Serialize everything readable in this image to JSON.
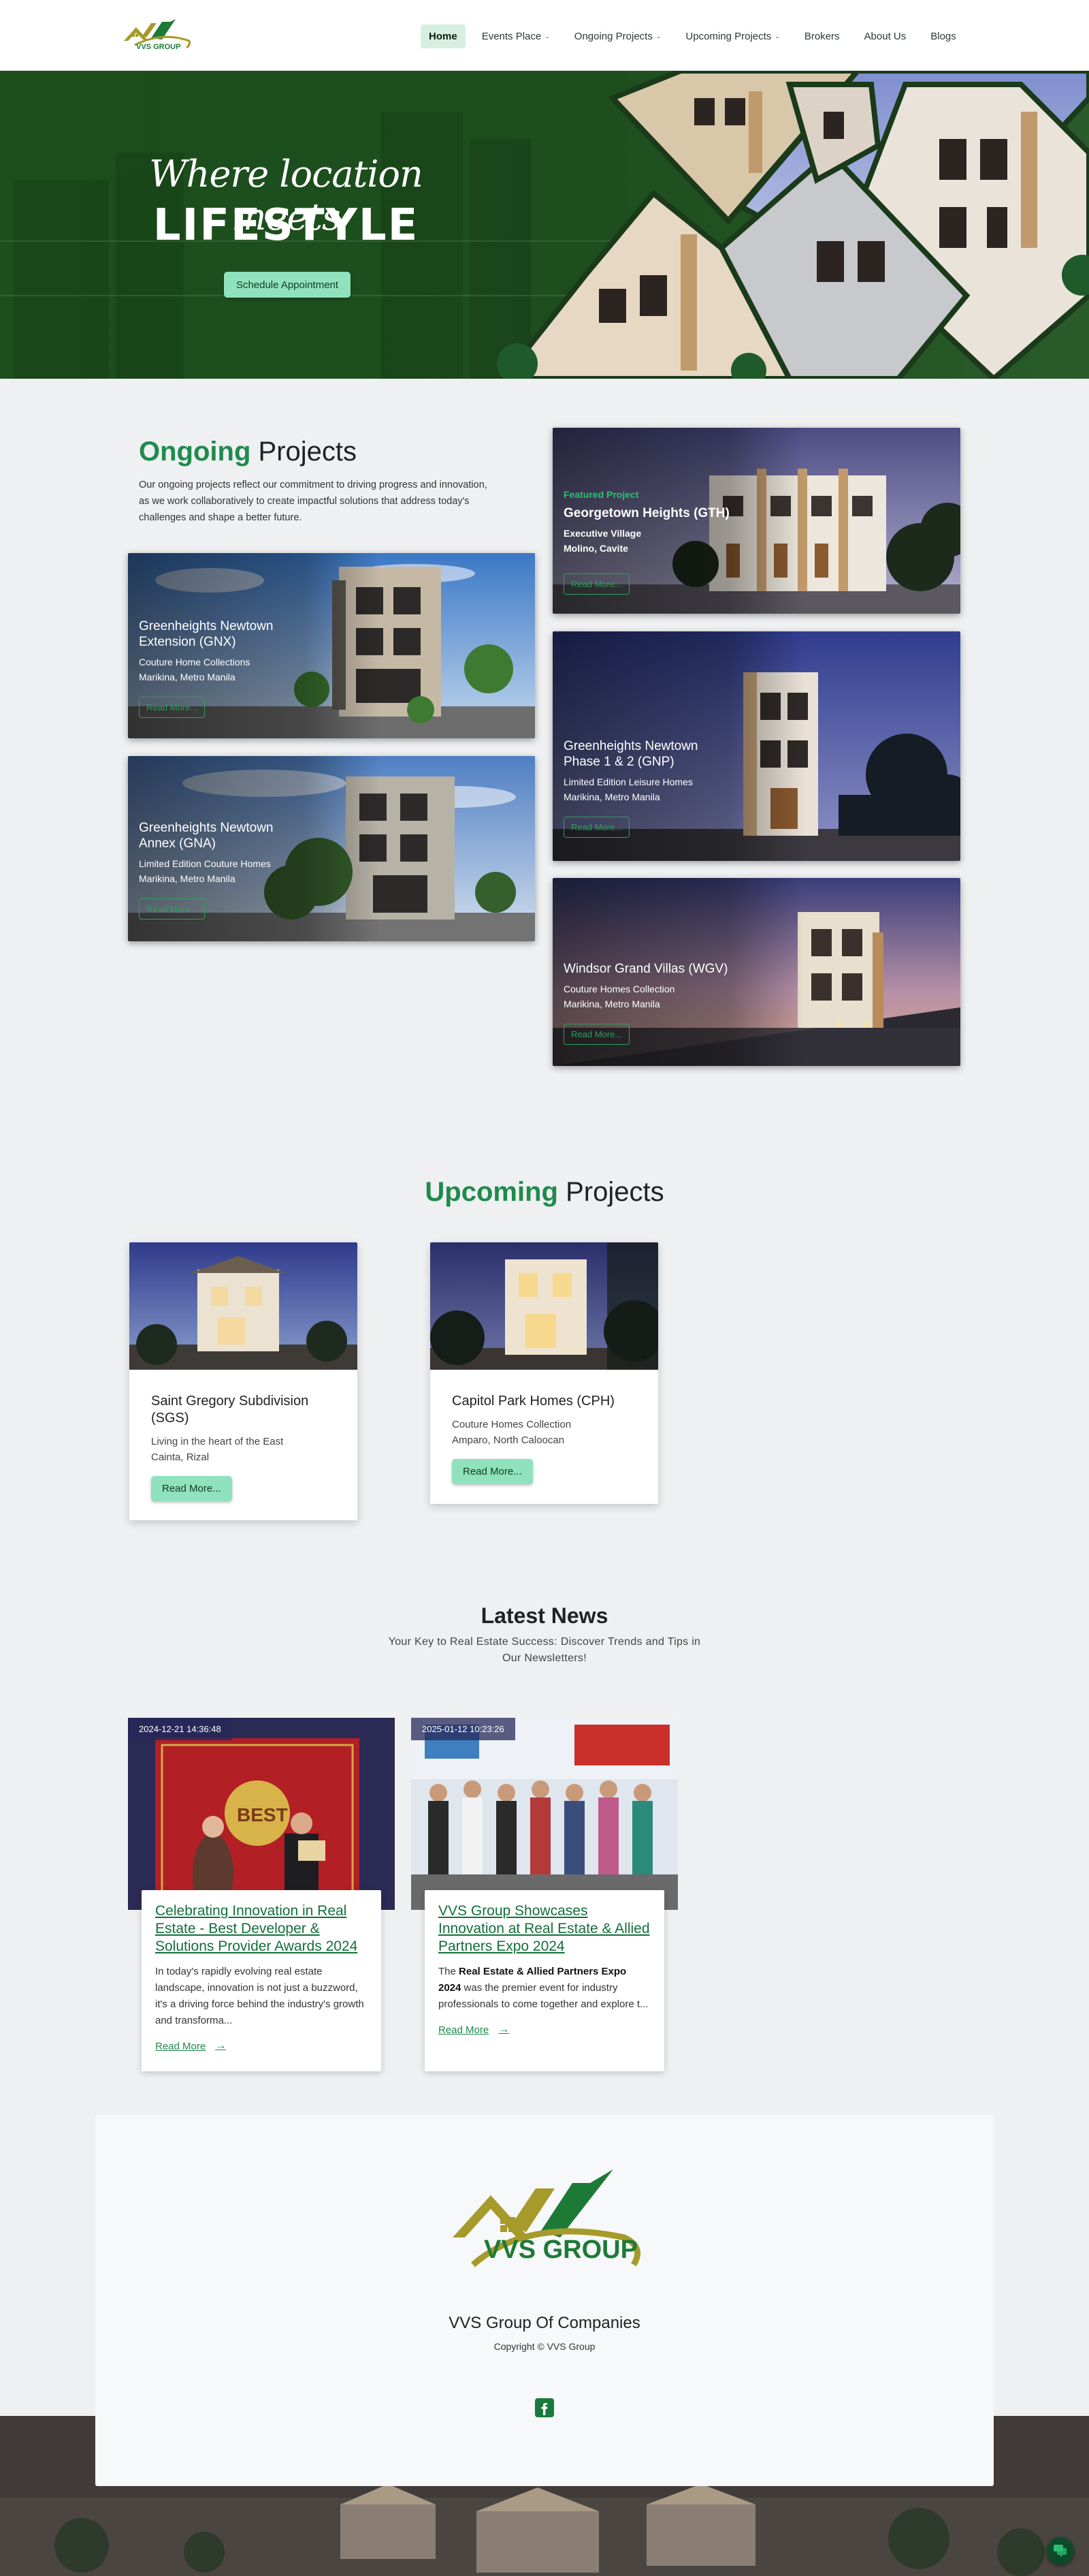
{
  "nav": {
    "logo_text": "VVS GROUP",
    "items": [
      {
        "label": "Home",
        "active": true,
        "dropdown": false
      },
      {
        "label": "Events Place",
        "active": false,
        "dropdown": true
      },
      {
        "label": "Ongoing Projects",
        "active": false,
        "dropdown": true
      },
      {
        "label": "Upcoming Projects",
        "active": false,
        "dropdown": true
      },
      {
        "label": "Brokers",
        "active": false,
        "dropdown": false
      },
      {
        "label": "About Us",
        "active": false,
        "dropdown": false
      },
      {
        "label": "Blogs",
        "active": false,
        "dropdown": false
      }
    ],
    "caret_icon": "chevron-down-icon"
  },
  "hero": {
    "script_text": "Where location meets",
    "title": "LIFESTYLE",
    "button_label": "Schedule Appointment"
  },
  "ongoing": {
    "title_accent": "Ongoing",
    "title_rest": "Projects",
    "description": "Our ongoing projects reflect our commitment to driving progress and innovation, as we work collaboratively to create impactful solutions that address today's challenges and shape a better future.",
    "cards": [
      {
        "featured_label": "Featured Project",
        "name": "Georgetown Heights (GTH)",
        "line1": "Executive Village",
        "line2": "Molino, Cavite",
        "button": "Read More..."
      },
      {
        "name": "Greenheights Newtown Extension (GNX)",
        "line1": "Couture Home Collections",
        "line2": "Marikina, Metro Manila",
        "button": "Read More..."
      },
      {
        "name": "Greenheights Newtown Phase 1 & 2 (GNP)",
        "line1": "Limited Edition Leisure Homes",
        "line2": "Marikina, Metro Manila",
        "button": "Read More..."
      },
      {
        "name": "Greenheights Newtown Annex (GNA)",
        "line1": "Limited Edition Couture Homes",
        "line2": "Marikina, Metro Manila",
        "button": "Read More..."
      },
      {
        "name": "Windsor Grand Villas (WGV)",
        "line1": "Couture Homes Collection",
        "line2": "Marikina, Metro Manila",
        "button": "Read More..."
      }
    ]
  },
  "upcoming": {
    "title_accent": "Upcoming",
    "title_rest": "Projects",
    "cards": [
      {
        "name": "Saint Gregory Subdivision (SGS)",
        "line1": "Living in the heart of the East",
        "line2": "Cainta, Rizal",
        "button": "Read More..."
      },
      {
        "name": "Capitol Park Homes (CPH)",
        "line1": "Couture Homes Collection",
        "line2": "Amparo, North Caloocan",
        "button": "Read More..."
      }
    ]
  },
  "news": {
    "title": "Latest News",
    "subtitle": "Your Key to Real Estate Success: Discover Trends and Tips in Our Newsletters!",
    "items": [
      {
        "date": "2024-12-21 14:36:48",
        "title": "Celebrating Innovation in Real Estate - Best Developer & Solutions Provider Awards 2024",
        "excerpt": "In today's rapidly evolving real estate landscape, innovation is not just a buzzword, it's a driving force behind the industry's growth and transforma...",
        "read_more": "Read More"
      },
      {
        "date": "2025-01-12 10:23:26",
        "title": "VVS Group Showcases Innovation at Real Estate & Allied Partners Expo 2024",
        "excerpt_prefix": "The ",
        "excerpt_bold": "Real Estate & Allied Partners Expo 2024",
        "excerpt_rest": " was the premier event for industry professionals to come together and explore t...",
        "read_more": "Read More"
      }
    ],
    "arrow_icon": "arrow-right-icon"
  },
  "footer": {
    "logo_text": "VVS GROUP",
    "company": "VVS Group Of Companies",
    "copyright": "Copyright © VVS Group",
    "social_icon": "facebook-icon"
  },
  "chat_icon": "chat-icon",
  "colors": {
    "accent_green": "#1f8a4c",
    "button_mint": "#8fe2bd",
    "hero_green": "#184418",
    "logo_olive": "#a59a2a",
    "logo_green": "#1d7a36"
  }
}
